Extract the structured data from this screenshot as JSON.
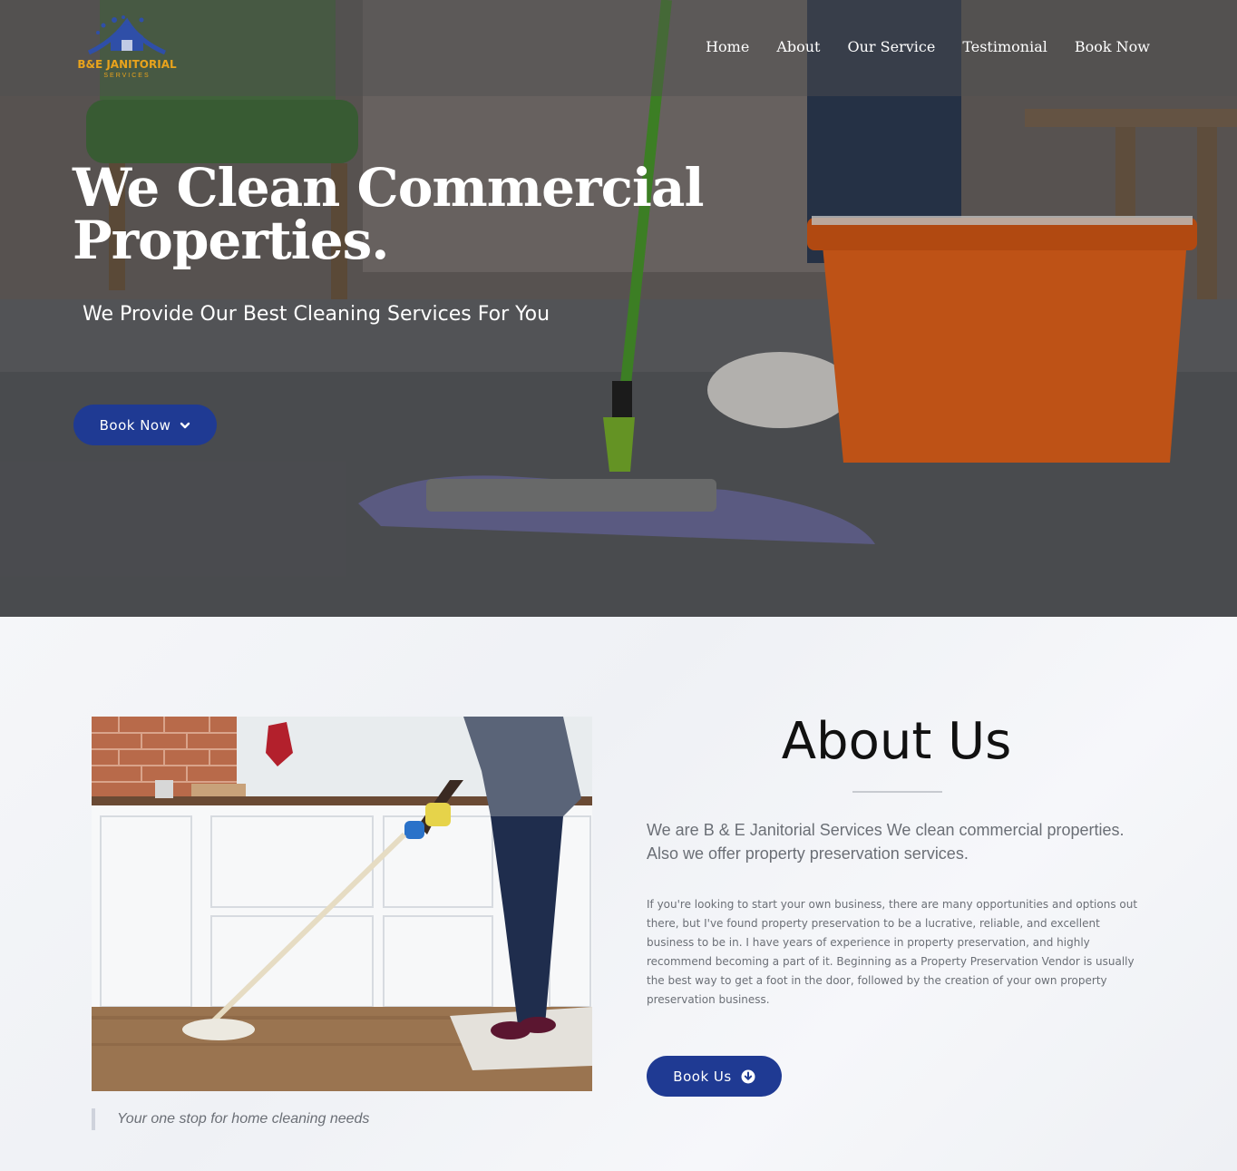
{
  "colors": {
    "brand_blue": "#1f3a93",
    "logo_gold": "#e9a31c",
    "text_gray": "#6b6f76",
    "heading_dark": "#111111"
  },
  "logo": {
    "name": "B&E JANITORIAL",
    "sub": "SERVICES",
    "icon": "house-logo-icon"
  },
  "nav": {
    "items": [
      {
        "label": "Home"
      },
      {
        "label": "About"
      },
      {
        "label": "Our Service"
      },
      {
        "label": "Testimonial"
      },
      {
        "label": "Book Now"
      }
    ]
  },
  "hero": {
    "title": "We Clean Commercial Properties.",
    "subtitle": "We Provide Our Best Cleaning Services For You",
    "button_label": "Book Now",
    "button_icon": "chevron-down-icon"
  },
  "about": {
    "title": "About Us",
    "lead": "We are B & E Janitorial Services We clean commercial properties. Also we offer property preservation services.",
    "body": "If you're looking to start your own business, there are many opportunities and options out there, but I've found property preservation to be a lucrative, reliable, and excellent business to be in. I have years of experience in property preservation, and highly recommend becoming a part of it. Beginning as a Property Preservation Vendor is usually the best way to get a foot in the door, followed by the creation of your own property preservation business.",
    "quote": "Your one stop for home cleaning needs",
    "button_label": "Book Us",
    "button_icon": "arrow-circle-down-icon"
  }
}
